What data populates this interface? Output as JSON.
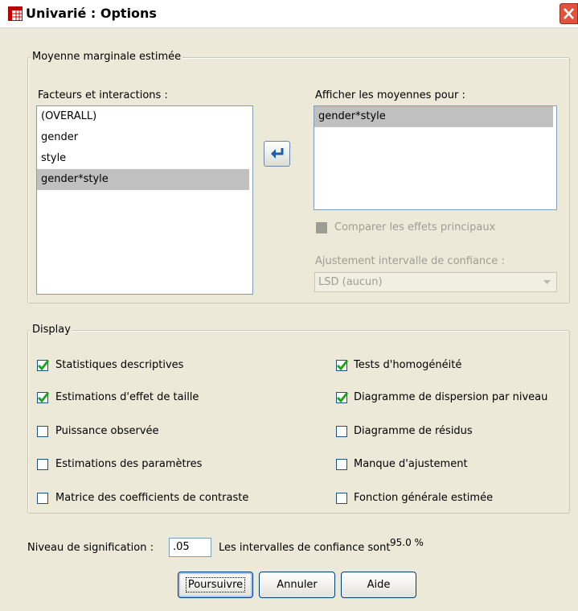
{
  "window": {
    "title": "Univarié : Options"
  },
  "emm": {
    "legend": "Moyenne marginale estimée",
    "factors_label": "Facteurs et interactions :",
    "factors": [
      {
        "label": "(OVERALL)",
        "selected": false
      },
      {
        "label": "gender",
        "selected": false
      },
      {
        "label": "style",
        "selected": false
      },
      {
        "label": "gender*style",
        "selected": true
      }
    ],
    "display_means_label": "Afficher les moyennes pour :",
    "display_means": [
      {
        "label": "gender*style",
        "selected": true
      }
    ],
    "compare_main_effects": {
      "label": "Comparer les effets principaux",
      "checked": false,
      "disabled": true
    },
    "ci_adjust_label": "Ajustement intervalle de confiance :",
    "ci_adjust_value": "LSD (aucun)"
  },
  "display": {
    "legend": "Display",
    "left": [
      {
        "label": "Statistiques descriptives",
        "checked": true
      },
      {
        "label": "Estimations d'effet de taille",
        "checked": true
      },
      {
        "label": "Puissance observée",
        "checked": false
      },
      {
        "label": "Estimations des paramètres",
        "checked": false
      },
      {
        "label": "Matrice des coefficients de contraste",
        "checked": false
      }
    ],
    "right": [
      {
        "label": "Tests d'homogénéité",
        "checked": true
      },
      {
        "label": "Diagramme de dispersion par niveau",
        "checked": true
      },
      {
        "label": "Diagramme de résidus",
        "checked": false
      },
      {
        "label": "Manque d'ajustement",
        "checked": false
      },
      {
        "label": "Fonction générale estimée",
        "checked": false
      }
    ]
  },
  "significance": {
    "label": "Niveau de signification :",
    "value": ".05",
    "ci_text": "Les intervalles de confiance sont",
    "ci_value": "95.0 %"
  },
  "buttons": {
    "continue": "Poursuivre",
    "cancel": "Annuler",
    "help": "Aide"
  },
  "colors": {
    "dialog_bg": "#ece9d8",
    "selection": "#c0c0c0",
    "close_button": "#e0533e",
    "checkmark": "#21a121"
  }
}
